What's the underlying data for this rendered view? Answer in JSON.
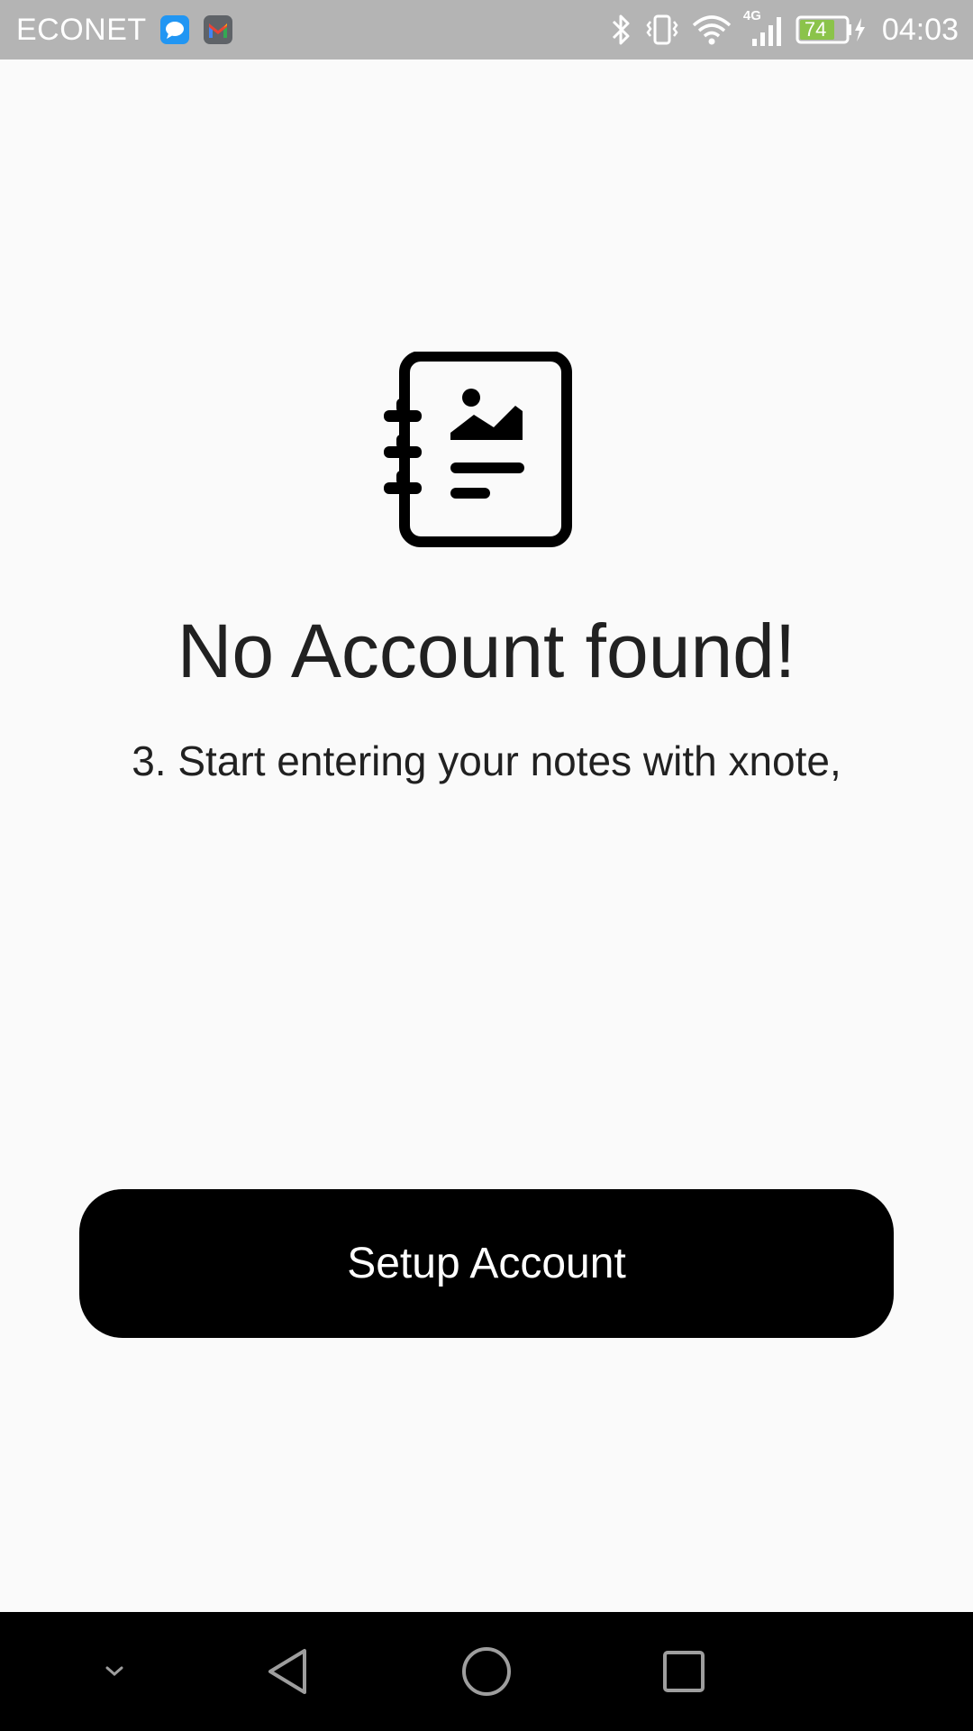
{
  "status_bar": {
    "carrier": "ECONET",
    "notification_icons": [
      "messages-icon",
      "gmail-icon"
    ],
    "system_icons": [
      "bluetooth-icon",
      "vibrate-icon",
      "wifi-icon",
      "signal-4g-icon",
      "battery-charging-icon"
    ],
    "network_type": "4G",
    "battery_level": "74",
    "time": "04:03"
  },
  "main": {
    "icon": "notebook-image-icon",
    "title": "No Account found!",
    "subtitle": "3. Start entering your notes with xnote,",
    "setup_button_label": "Setup Account"
  },
  "nav_bar": {
    "buttons": [
      "collapse-icon",
      "back-icon",
      "home-icon",
      "recents-icon"
    ]
  },
  "colors": {
    "status_bar_bg": "#b4b4b4",
    "background": "#fafafa",
    "text": "#212121",
    "button_bg": "#000000",
    "button_text": "#ffffff",
    "battery_fill": "#8bc34a",
    "nav_bar_bg": "#000000"
  }
}
